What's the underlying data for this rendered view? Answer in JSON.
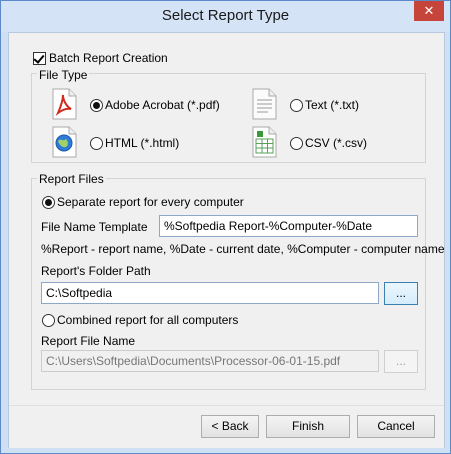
{
  "window": {
    "title": "Select Report Type",
    "close_glyph": "✕"
  },
  "batch": {
    "label": "Batch Report Creation",
    "checked": true
  },
  "file_type": {
    "group_label": "File Type",
    "options": [
      {
        "label": "Adobe Acrobat (*.pdf)",
        "icon": "pdf-file-icon",
        "selected": true
      },
      {
        "label": "Text (*.txt)",
        "icon": "text-file-icon",
        "selected": false
      },
      {
        "label": "HTML (*.html)",
        "icon": "html-file-icon",
        "selected": false
      },
      {
        "label": "CSV (*.csv)",
        "icon": "csv-file-icon",
        "selected": false
      }
    ]
  },
  "report_files": {
    "group_label": "Report Files",
    "separate_label": "Separate report for every computer",
    "name_template_label": "File Name Template",
    "name_template_value": "%Softpedia Report-%Computer-%Date",
    "template_hint": "%Report - report name, %Date - current date, %Computer - computer name",
    "folder_label": "Report's Folder Path",
    "folder_value": "C:\\Softpedia",
    "browse_label": "...",
    "combined_label": "Combined report for all computers",
    "file_name_label": "Report File Name",
    "file_name_value": "C:\\Users\\Softpedia\\Documents\\Processor-06-01-15.pdf",
    "browse2_label": "..."
  },
  "buttons": {
    "back": "< Back",
    "finish": "Finish",
    "cancel": "Cancel"
  },
  "colors": {
    "accent": "#3c7fb1",
    "close": "#c7443a",
    "pdf_red": "#d12a1e"
  }
}
